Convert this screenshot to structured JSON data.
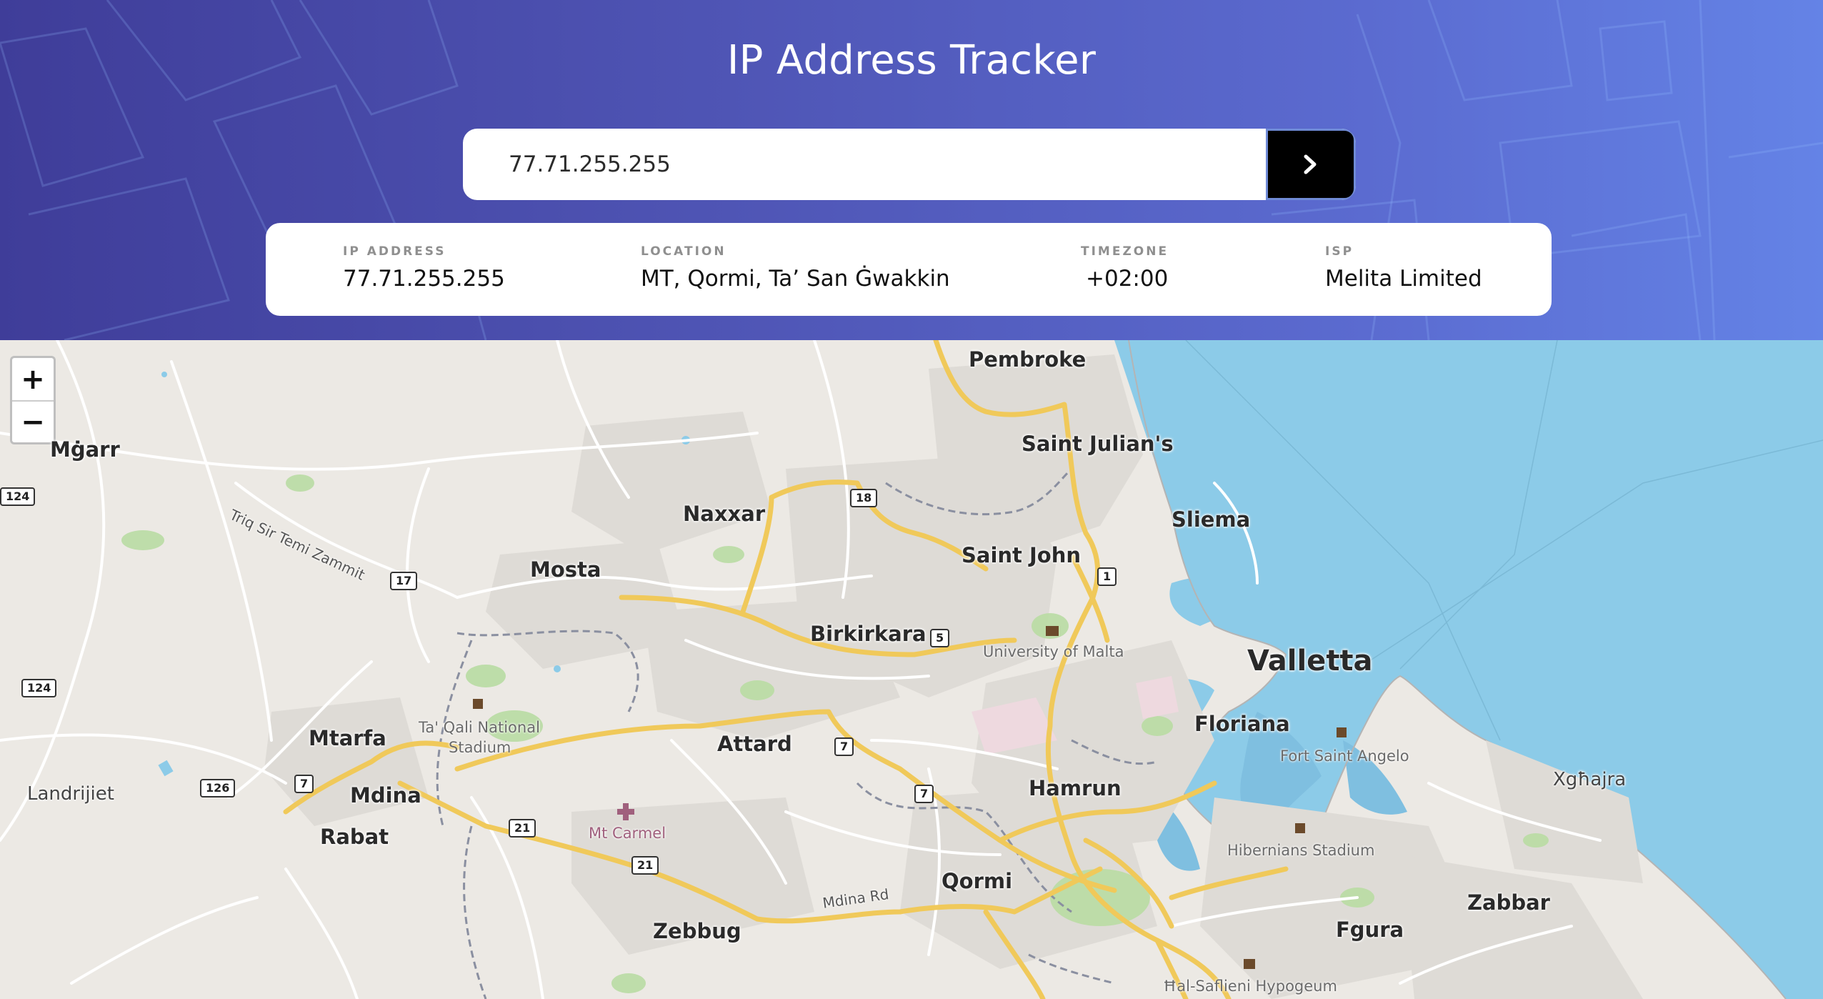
{
  "app": {
    "title": "IP Address Tracker"
  },
  "search": {
    "value": "77.71.255.255",
    "button_icon": "chevron-right-icon"
  },
  "info": {
    "ip_label": "IP ADDRESS",
    "ip_value": "77.71.255.255",
    "location_label": "LOCATION",
    "location_value": "MT, Qormi, Ta’ San Ġwakkin",
    "timezone_label": "TIMEZONE",
    "timezone_value": "+02:00",
    "isp_label": "ISP",
    "isp_value": "Melita Limited"
  },
  "map": {
    "zoom_in": "+",
    "zoom_out": "−",
    "places": {
      "pembroke": "Pembroke",
      "saint_julians": "Saint Julian's",
      "sliema": "Sliema",
      "mgarr": "Mġarr",
      "naxxar": "Naxxar",
      "saint_john": "Saint John",
      "mosta": "Mosta",
      "birkirkara": "Birkirkara",
      "valletta": "Valletta",
      "floriana": "Floriana",
      "mtarfa": "Mtarfa",
      "attard": "Attard",
      "mdina": "Mdina",
      "rabat": "Rabat",
      "landrijiet": "Landrijiet",
      "hamrun": "Hamrun",
      "xghajra": "Xgħajra",
      "qormi": "Qormi",
      "zabbar": "Zabbar",
      "zebbug": "Zebbug",
      "fgura": "Fgura"
    },
    "pois": {
      "university": "University of Malta",
      "stadium_line1": "Ta' Qali National",
      "stadium_line2": "Stadium",
      "fort": "Fort Saint Angelo",
      "mt_carmel": "Mt Carmel",
      "hibernians": "Hibernians Stadium",
      "hypogeum": "Ħal-Saflieni Hypogeum"
    },
    "streets": {
      "triq_sir_temi": "Triq Sir Temi Zammit",
      "mdina_rd": "Mdina Rd"
    },
    "shields": {
      "r18": "18",
      "r17": "17",
      "r124a": "124",
      "r124b": "124",
      "r1": "1",
      "r5": "5",
      "r126": "126",
      "r7a": "7",
      "r7b": "7",
      "r7c": "7",
      "r21a": "21",
      "r21b": "21"
    }
  },
  "colors": {
    "header_gradient_start": "#3f3d99",
    "header_gradient_end": "#6483e6",
    "button": "#000000",
    "sea": "#8ccbe8",
    "land": "#ece9e4",
    "major_road": "#f0c95a",
    "green_area": "#b9dca3"
  }
}
